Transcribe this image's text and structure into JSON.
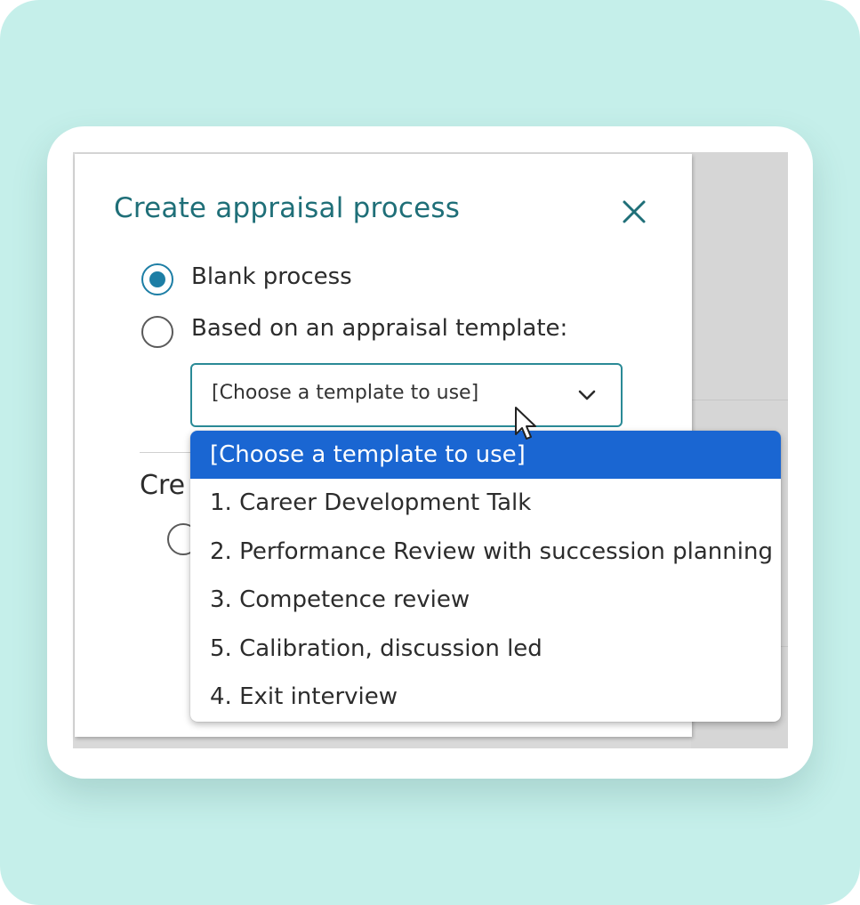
{
  "modal": {
    "title": "Create appraisal process",
    "close_icon": "close-icon",
    "options": [
      {
        "label": "Blank process",
        "checked": true
      },
      {
        "label": "Based on an appraisal template:",
        "checked": false
      }
    ],
    "template_select": {
      "value": "[Choose a template to use]",
      "icon": "chevron-down-icon",
      "options": [
        "[Choose a template to use]",
        "1. Career Development Talk",
        "2. Performance Review with succession planning",
        "3. Competence review",
        "5. Calibration, discussion led",
        "4. Exit interview"
      ],
      "selected_index": 0
    },
    "partial_section_label": "Cre"
  },
  "colors": {
    "background": "#c5efea",
    "title": "#1f6f78",
    "radio_checked": "#1d7ea5",
    "select_border": "#2a8a96",
    "dropdown_highlight": "#1a66d2"
  }
}
